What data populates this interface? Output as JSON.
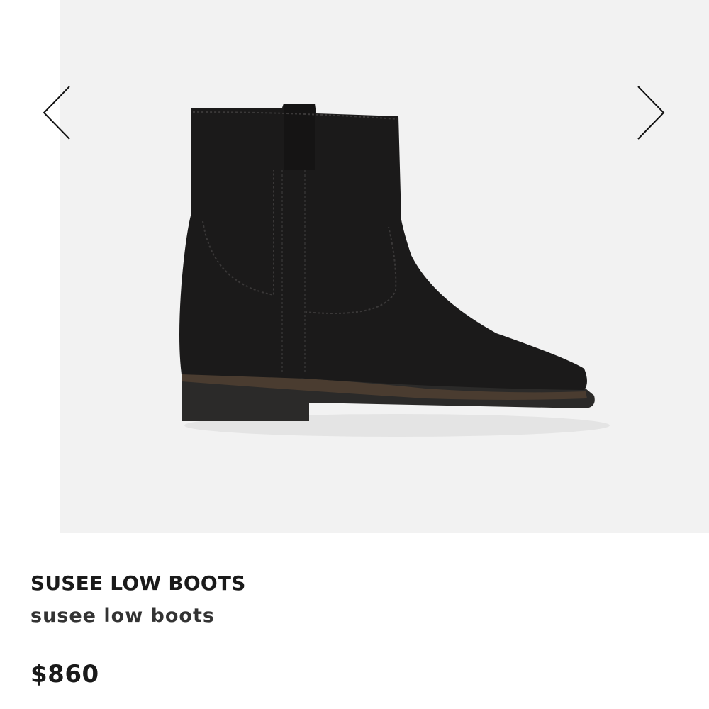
{
  "product": {
    "name": "SUSEE LOW BOOTS",
    "subtitle": "susee low boots",
    "price": "$860",
    "image_alt": "Black suede ankle boot"
  },
  "gallery": {
    "prev_icon": "chevron-left-icon",
    "next_icon": "chevron-right-icon"
  },
  "colors": {
    "image_background": "#f2f2f2",
    "boot": "#1b1a1a",
    "text": "#1a1a1a"
  }
}
